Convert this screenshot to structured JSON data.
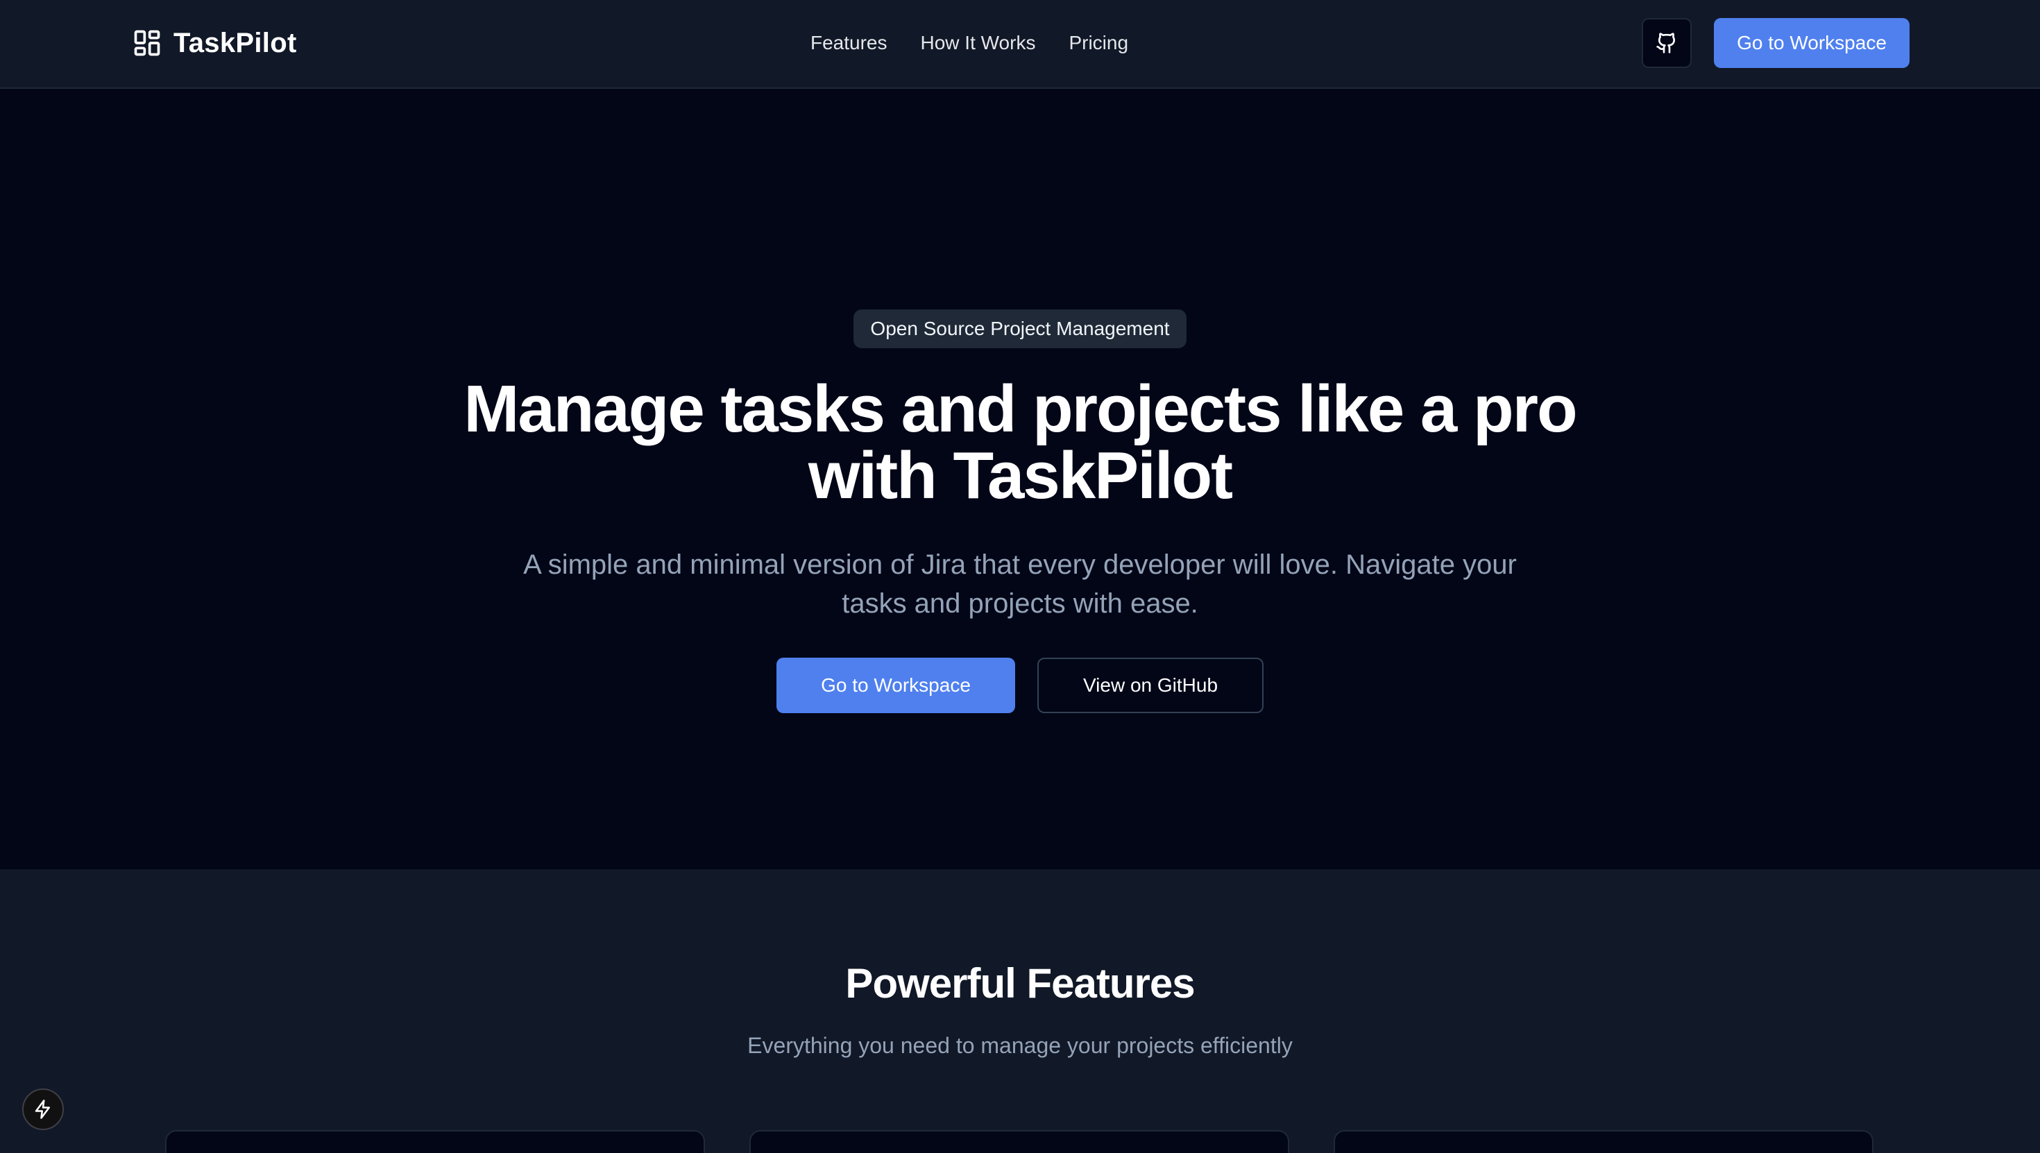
{
  "header": {
    "brand": "TaskPilot",
    "nav": [
      {
        "label": "Features"
      },
      {
        "label": "How It Works"
      },
      {
        "label": "Pricing"
      }
    ],
    "cta_label": "Go to Workspace",
    "github_icon": "github-icon"
  },
  "hero": {
    "badge": "Open Source Project Management",
    "title_line1": "Manage tasks and projects like a pro",
    "title_line2": "with TaskPilot",
    "subtitle": "A simple and minimal version of Jira that every developer will love. Navigate your tasks and projects with ease.",
    "primary_label": "Go to Workspace",
    "secondary_label": "View on GitHub"
  },
  "features": {
    "title": "Powerful Features",
    "subtitle": "Everything you need to manage your projects efficiently"
  },
  "floating": {
    "icon": "lightning-bolt-icon"
  },
  "colors": {
    "background": "#020617",
    "header_bg": "#111827",
    "accent": "#4f80ee",
    "muted_text": "#94a3b8"
  }
}
